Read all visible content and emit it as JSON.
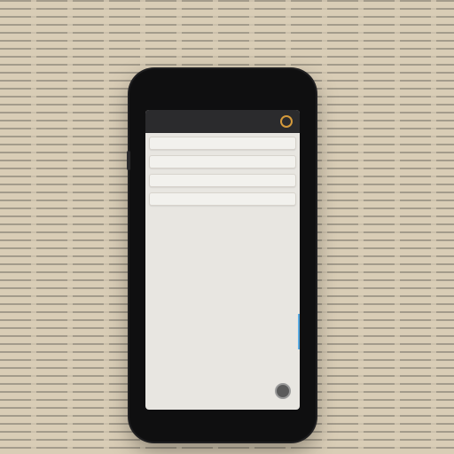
{
  "app": {
    "title": "",
    "header_icon": "info-icon"
  },
  "feed": {
    "items": [
      {
        "title": "",
        "body": "",
        "meta": ""
      },
      {
        "title": "",
        "body": "",
        "meta": ""
      },
      {
        "title": "",
        "body": "",
        "meta": ""
      },
      {
        "title": "",
        "body": "",
        "meta": ""
      }
    ]
  },
  "fab": {
    "icon": "circle-action-icon"
  },
  "colors": {
    "accent": "#d59a3b",
    "meta_text": "#c17b25",
    "phone_body": "#0f0f10",
    "app_bar": "#2b2b2d",
    "background": "#d9cdb6",
    "edge_highlight": "#58a9e0"
  }
}
